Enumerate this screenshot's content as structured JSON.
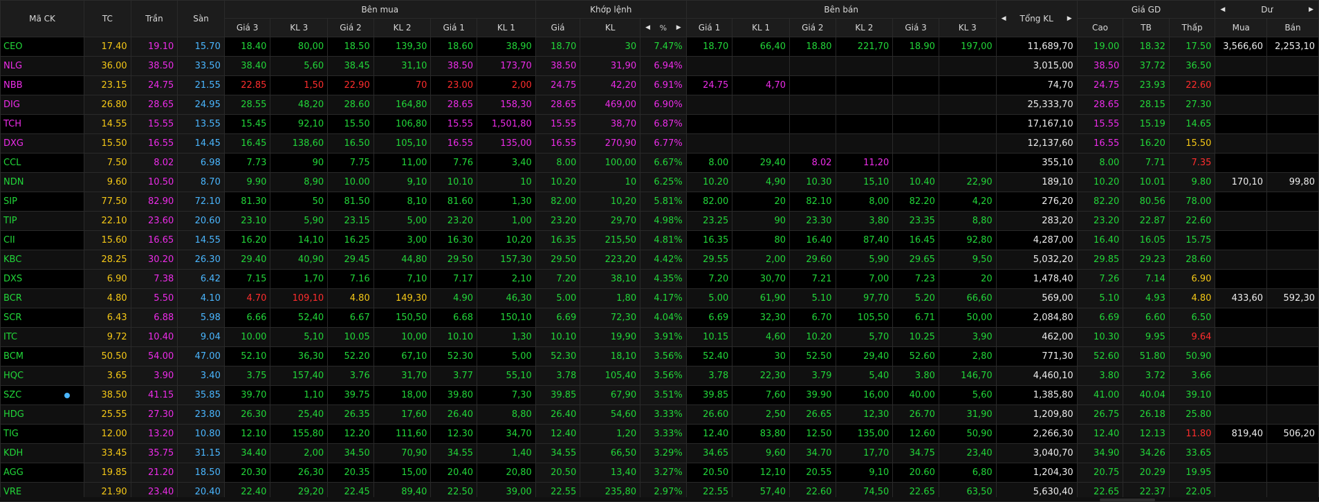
{
  "headers": {
    "symbol": "Mã CK",
    "tc": "TC",
    "ceiling": "Trần",
    "floor": "Sàn",
    "buy_group": "Bên mua",
    "match_group": "Khớp lệnh",
    "sell_group": "Bên bán",
    "total_vol": "Tổng KL",
    "price_group": "Giá GD",
    "remain_group": "Dư",
    "buy_sub": [
      "Giá 3",
      "KL 3",
      "Giá 2",
      "KL 2",
      "Giá 1",
      "KL 1"
    ],
    "match_sub": [
      "Giá",
      "KL",
      "%"
    ],
    "sell_sub": [
      "Giá 1",
      "KL 1",
      "Giá 2",
      "KL 2",
      "Giá 3",
      "KL 3"
    ],
    "price_sub": [
      "Cao",
      "TB",
      "Thấp"
    ],
    "remain_sub": [
      "Mua",
      "Bán"
    ]
  },
  "colors": {
    "up": "#22d639",
    "down": "#ff2d2d",
    "ref": "#f5c816",
    "ceiling": "#ec2ce8",
    "floor": "#4ab6ff",
    "neutral": "#ececec"
  },
  "rows": [
    {
      "sym": "CEO",
      "tc": "17.40",
      "ceil": "19.10",
      "floor": "15.70",
      "buy": [
        "18.40",
        "80,00",
        "18.50",
        "139,30",
        "18.60",
        "38,90"
      ],
      "match": [
        "18.70",
        "30",
        "7.47%"
      ],
      "sell": [
        "18.70",
        "66,40",
        "18.80",
        "221,70",
        "18.90",
        "197,00"
      ],
      "total": "11,689,70",
      "hi": "19.00",
      "avg": "18.32",
      "lo": "17.50",
      "rbuy": "3,566,60",
      "rsell": "2,253,10"
    },
    {
      "sym": "NLG",
      "tc": "36.00",
      "ceil": "38.50",
      "floor": "33.50",
      "buy": [
        "38.40",
        "5,60",
        "38.45",
        "31,10",
        "38.50",
        "173,70"
      ],
      "match": [
        "38.50",
        "31,90",
        "6.94%"
      ],
      "sell": [
        "",
        "",
        "",
        "",
        "",
        ""
      ],
      "total": "3,015,00",
      "hi": "38.50",
      "avg": "37.72",
      "lo": "36.50",
      "rbuy": "",
      "rsell": ""
    },
    {
      "sym": "NBB",
      "tc": "23.15",
      "ceil": "24.75",
      "floor": "21.55",
      "buy": [
        "22.85",
        "1,50",
        "22.90",
        "70",
        "23.00",
        "2,00"
      ],
      "match": [
        "24.75",
        "42,20",
        "6.91%"
      ],
      "sell": [
        "24.75",
        "4,70",
        "",
        "",
        "",
        ""
      ],
      "total": "74,70",
      "hi": "24.75",
      "avg": "23.93",
      "lo": "22.60",
      "rbuy": "",
      "rsell": ""
    },
    {
      "sym": "DIG",
      "tc": "26.80",
      "ceil": "28.65",
      "floor": "24.95",
      "buy": [
        "28.55",
        "48,20",
        "28.60",
        "164,80",
        "28.65",
        "158,30"
      ],
      "match": [
        "28.65",
        "469,00",
        "6.90%"
      ],
      "sell": [
        "",
        "",
        "",
        "",
        "",
        ""
      ],
      "total": "25,333,70",
      "hi": "28.65",
      "avg": "28.15",
      "lo": "27.30",
      "rbuy": "",
      "rsell": ""
    },
    {
      "sym": "TCH",
      "tc": "14.55",
      "ceil": "15.55",
      "floor": "13.55",
      "buy": [
        "15.45",
        "92,10",
        "15.50",
        "106,80",
        "15.55",
        "1,501,80"
      ],
      "match": [
        "15.55",
        "38,70",
        "6.87%"
      ],
      "sell": [
        "",
        "",
        "",
        "",
        "",
        ""
      ],
      "total": "17,167,10",
      "hi": "15.55",
      "avg": "15.19",
      "lo": "14.65",
      "rbuy": "",
      "rsell": ""
    },
    {
      "sym": "DXG",
      "tc": "15.50",
      "ceil": "16.55",
      "floor": "14.45",
      "buy": [
        "16.45",
        "138,60",
        "16.50",
        "105,10",
        "16.55",
        "135,00"
      ],
      "match": [
        "16.55",
        "270,90",
        "6.77%"
      ],
      "sell": [
        "",
        "",
        "",
        "",
        "",
        ""
      ],
      "total": "12,137,60",
      "hi": "16.55",
      "avg": "16.20",
      "lo": "15.50",
      "rbuy": "",
      "rsell": ""
    },
    {
      "sym": "CCL",
      "tc": "7.50",
      "ceil": "8.02",
      "floor": "6.98",
      "buy": [
        "7.73",
        "90",
        "7.75",
        "11,00",
        "7.76",
        "3,40"
      ],
      "match": [
        "8.00",
        "100,00",
        "6.67%"
      ],
      "sell": [
        "8.00",
        "29,40",
        "8.02",
        "11,20",
        "",
        ""
      ],
      "total": "355,10",
      "hi": "8.00",
      "avg": "7.71",
      "lo": "7.35",
      "rbuy": "",
      "rsell": ""
    },
    {
      "sym": "NDN",
      "tc": "9.60",
      "ceil": "10.50",
      "floor": "8.70",
      "buy": [
        "9.90",
        "8,90",
        "10.00",
        "9,10",
        "10.10",
        "10"
      ],
      "match": [
        "10.20",
        "10",
        "6.25%"
      ],
      "sell": [
        "10.20",
        "4,90",
        "10.30",
        "15,10",
        "10.40",
        "22,90"
      ],
      "total": "189,10",
      "hi": "10.20",
      "avg": "10.01",
      "lo": "9.80",
      "rbuy": "170,10",
      "rsell": "99,80"
    },
    {
      "sym": "SIP",
      "tc": "77.50",
      "ceil": "82.90",
      "floor": "72.10",
      "buy": [
        "81.30",
        "50",
        "81.50",
        "8,10",
        "81.60",
        "1,30"
      ],
      "match": [
        "82.00",
        "10,20",
        "5.81%"
      ],
      "sell": [
        "82.00",
        "20",
        "82.10",
        "8,00",
        "82.20",
        "4,20"
      ],
      "total": "276,20",
      "hi": "82.20",
      "avg": "80.56",
      "lo": "78.00",
      "rbuy": "",
      "rsell": ""
    },
    {
      "sym": "TIP",
      "tc": "22.10",
      "ceil": "23.60",
      "floor": "20.60",
      "buy": [
        "23.10",
        "5,90",
        "23.15",
        "5,00",
        "23.20",
        "1,00"
      ],
      "match": [
        "23.20",
        "29,70",
        "4.98%"
      ],
      "sell": [
        "23.25",
        "90",
        "23.30",
        "3,80",
        "23.35",
        "8,80"
      ],
      "total": "283,20",
      "hi": "23.20",
      "avg": "22.87",
      "lo": "22.60",
      "rbuy": "",
      "rsell": ""
    },
    {
      "sym": "CII",
      "tc": "15.60",
      "ceil": "16.65",
      "floor": "14.55",
      "buy": [
        "16.20",
        "14,10",
        "16.25",
        "3,00",
        "16.30",
        "10,20"
      ],
      "match": [
        "16.35",
        "215,50",
        "4.81%"
      ],
      "sell": [
        "16.35",
        "80",
        "16.40",
        "87,40",
        "16.45",
        "92,80"
      ],
      "total": "4,287,00",
      "hi": "16.40",
      "avg": "16.05",
      "lo": "15.75",
      "rbuy": "",
      "rsell": ""
    },
    {
      "sym": "KBC",
      "tc": "28.25",
      "ceil": "30.20",
      "floor": "26.30",
      "buy": [
        "29.40",
        "40,90",
        "29.45",
        "44,80",
        "29.50",
        "157,30"
      ],
      "match": [
        "29.50",
        "223,20",
        "4.42%"
      ],
      "sell": [
        "29.55",
        "2,00",
        "29.60",
        "5,90",
        "29.65",
        "9,50"
      ],
      "total": "5,032,20",
      "hi": "29.85",
      "avg": "29.23",
      "lo": "28.60",
      "rbuy": "",
      "rsell": ""
    },
    {
      "sym": "DXS",
      "tc": "6.90",
      "ceil": "7.38",
      "floor": "6.42",
      "buy": [
        "7.15",
        "1,70",
        "7.16",
        "7,10",
        "7.17",
        "2,10"
      ],
      "match": [
        "7.20",
        "38,10",
        "4.35%"
      ],
      "sell": [
        "7.20",
        "30,70",
        "7.21",
        "7,00",
        "7.23",
        "20"
      ],
      "total": "1,478,40",
      "hi": "7.26",
      "avg": "7.14",
      "lo": "6.90",
      "rbuy": "",
      "rsell": ""
    },
    {
      "sym": "BCR",
      "tc": "4.80",
      "ceil": "5.50",
      "floor": "4.10",
      "buy": [
        "4.70",
        "109,10",
        "4.80",
        "149,30",
        "4.90",
        "46,30"
      ],
      "match": [
        "5.00",
        "1,80",
        "4.17%"
      ],
      "sell": [
        "5.00",
        "61,90",
        "5.10",
        "97,70",
        "5.20",
        "66,60"
      ],
      "total": "569,00",
      "hi": "5.10",
      "avg": "4.93",
      "lo": "4.80",
      "rbuy": "433,60",
      "rsell": "592,30"
    },
    {
      "sym": "SCR",
      "tc": "6.43",
      "ceil": "6.88",
      "floor": "5.98",
      "buy": [
        "6.66",
        "52,40",
        "6.67",
        "150,50",
        "6.68",
        "150,10"
      ],
      "match": [
        "6.69",
        "72,30",
        "4.04%"
      ],
      "sell": [
        "6.69",
        "32,30",
        "6.70",
        "105,50",
        "6.71",
        "50,00"
      ],
      "total": "2,084,80",
      "hi": "6.69",
      "avg": "6.60",
      "lo": "6.50",
      "rbuy": "",
      "rsell": ""
    },
    {
      "sym": "ITC",
      "tc": "9.72",
      "ceil": "10.40",
      "floor": "9.04",
      "buy": [
        "10.00",
        "5,10",
        "10.05",
        "10,00",
        "10.10",
        "1,30"
      ],
      "match": [
        "10.10",
        "19,90",
        "3.91%"
      ],
      "sell": [
        "10.15",
        "4,60",
        "10.20",
        "5,70",
        "10.25",
        "3,90"
      ],
      "total": "462,00",
      "hi": "10.30",
      "avg": "9.95",
      "lo": "9.64",
      "rbuy": "",
      "rsell": ""
    },
    {
      "sym": "BCM",
      "tc": "50.50",
      "ceil": "54.00",
      "floor": "47.00",
      "buy": [
        "52.10",
        "36,30",
        "52.20",
        "67,10",
        "52.30",
        "5,00"
      ],
      "match": [
        "52.30",
        "18,10",
        "3.56%"
      ],
      "sell": [
        "52.40",
        "30",
        "52.50",
        "29,40",
        "52.60",
        "2,80"
      ],
      "total": "771,30",
      "hi": "52.60",
      "avg": "51.80",
      "lo": "50.90",
      "rbuy": "",
      "rsell": ""
    },
    {
      "sym": "HQC",
      "tc": "3.65",
      "ceil": "3.90",
      "floor": "3.40",
      "buy": [
        "3.75",
        "157,40",
        "3.76",
        "31,70",
        "3.77",
        "55,10"
      ],
      "match": [
        "3.78",
        "105,40",
        "3.56%"
      ],
      "sell": [
        "3.78",
        "22,30",
        "3.79",
        "5,40",
        "3.80",
        "146,70"
      ],
      "total": "4,460,10",
      "hi": "3.80",
      "avg": "3.72",
      "lo": "3.66",
      "rbuy": "",
      "rsell": ""
    },
    {
      "sym": "SZC",
      "tc": "38.50",
      "ceil": "41.15",
      "floor": "35.85",
      "buy": [
        "39.70",
        "1,10",
        "39.75",
        "18,00",
        "39.80",
        "7,30"
      ],
      "match": [
        "39.85",
        "67,90",
        "3.51%"
      ],
      "sell": [
        "39.85",
        "7,60",
        "39.90",
        "16,00",
        "40.00",
        "5,60"
      ],
      "total": "1,385,80",
      "hi": "41.00",
      "avg": "40.04",
      "lo": "39.10",
      "rbuy": "",
      "rsell": "",
      "dot": true
    },
    {
      "sym": "HDG",
      "tc": "25.55",
      "ceil": "27.30",
      "floor": "23.80",
      "buy": [
        "26.30",
        "25,40",
        "26.35",
        "17,60",
        "26.40",
        "8,80"
      ],
      "match": [
        "26.40",
        "54,60",
        "3.33%"
      ],
      "sell": [
        "26.60",
        "2,50",
        "26.65",
        "12,30",
        "26.70",
        "31,90"
      ],
      "total": "1,209,80",
      "hi": "26.75",
      "avg": "26.18",
      "lo": "25.80",
      "rbuy": "",
      "rsell": ""
    },
    {
      "sym": "TIG",
      "tc": "12.00",
      "ceil": "13.20",
      "floor": "10.80",
      "buy": [
        "12.10",
        "155,80",
        "12.20",
        "111,60",
        "12.30",
        "34,70"
      ],
      "match": [
        "12.40",
        "1,20",
        "3.33%"
      ],
      "sell": [
        "12.40",
        "83,80",
        "12.50",
        "135,00",
        "12.60",
        "50,90"
      ],
      "total": "2,266,30",
      "hi": "12.40",
      "avg": "12.13",
      "lo": "11.80",
      "rbuy": "819,40",
      "rsell": "506,20"
    },
    {
      "sym": "KDH",
      "tc": "33.45",
      "ceil": "35.75",
      "floor": "31.15",
      "buy": [
        "34.40",
        "2,00",
        "34.50",
        "70,90",
        "34.55",
        "1,40"
      ],
      "match": [
        "34.55",
        "66,50",
        "3.29%"
      ],
      "sell": [
        "34.65",
        "9,60",
        "34.70",
        "17,70",
        "34.75",
        "23,40"
      ],
      "total": "3,040,70",
      "hi": "34.90",
      "avg": "34.26",
      "lo": "33.65",
      "rbuy": "",
      "rsell": ""
    },
    {
      "sym": "AGG",
      "tc": "19.85",
      "ceil": "21.20",
      "floor": "18.50",
      "buy": [
        "20.30",
        "26,30",
        "20.35",
        "15,00",
        "20.40",
        "20,80"
      ],
      "match": [
        "20.50",
        "13,40",
        "3.27%"
      ],
      "sell": [
        "20.50",
        "12,10",
        "20.55",
        "9,10",
        "20.60",
        "6,80"
      ],
      "total": "1,204,30",
      "hi": "20.75",
      "avg": "20.29",
      "lo": "19.95",
      "rbuy": "",
      "rsell": ""
    },
    {
      "sym": "VRE",
      "tc": "21.90",
      "ceil": "23.40",
      "floor": "20.40",
      "buy": [
        "22.40",
        "29,20",
        "22.45",
        "89,40",
        "22.50",
        "39,00"
      ],
      "match": [
        "22.55",
        "235,80",
        "2.97%"
      ],
      "sell": [
        "22.55",
        "57,40",
        "22.60",
        "74,50",
        "22.65",
        "63,50"
      ],
      "total": "5,630,40",
      "hi": "22.65",
      "avg": "22.37",
      "lo": "22.05",
      "rbuy": "",
      "rsell": ""
    }
  ]
}
